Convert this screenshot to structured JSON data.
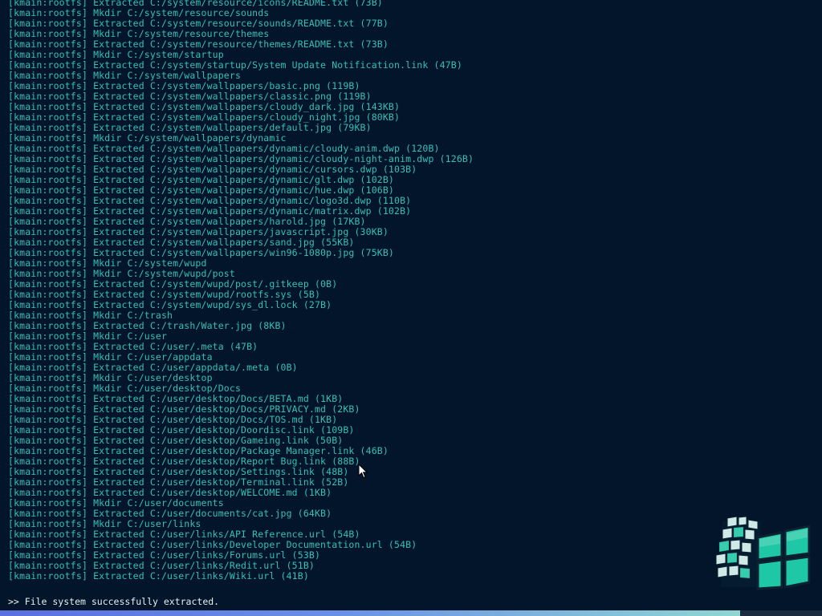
{
  "log": {
    "lines": [
      "[kmain:rootfs] Extracted C:/system/resource/icons/README.txt (73B)",
      "[kmain:rootfs] Mkdir C:/system/resource/sounds",
      "[kmain:rootfs] Extracted C:/system/resource/sounds/README.txt (77B)",
      "[kmain:rootfs] Mkdir C:/system/resource/themes",
      "[kmain:rootfs] Extracted C:/system/resource/themes/README.txt (73B)",
      "[kmain:rootfs] Mkdir C:/system/startup",
      "[kmain:rootfs] Extracted C:/system/startup/System Update Notification.link (47B)",
      "[kmain:rootfs] Mkdir C:/system/wallpapers",
      "[kmain:rootfs] Extracted C:/system/wallpapers/basic.png (119B)",
      "[kmain:rootfs] Extracted C:/system/wallpapers/classic.png (119B)",
      "[kmain:rootfs] Extracted C:/system/wallpapers/cloudy_dark.jpg (143KB)",
      "[kmain:rootfs] Extracted C:/system/wallpapers/cloudy_night.jpg (80KB)",
      "[kmain:rootfs] Extracted C:/system/wallpapers/default.jpg (79KB)",
      "[kmain:rootfs] Mkdir C:/system/wallpapers/dynamic",
      "[kmain:rootfs] Extracted C:/system/wallpapers/dynamic/cloudy-anim.dwp (120B)",
      "[kmain:rootfs] Extracted C:/system/wallpapers/dynamic/cloudy-night-anim.dwp (126B)",
      "[kmain:rootfs] Extracted C:/system/wallpapers/dynamic/cursors.dwp (103B)",
      "[kmain:rootfs] Extracted C:/system/wallpapers/dynamic/glt.dwp (102B)",
      "[kmain:rootfs] Extracted C:/system/wallpapers/dynamic/hue.dwp (106B)",
      "[kmain:rootfs] Extracted C:/system/wallpapers/dynamic/logo3d.dwp (110B)",
      "[kmain:rootfs] Extracted C:/system/wallpapers/dynamic/matrix.dwp (102B)",
      "[kmain:rootfs] Extracted C:/system/wallpapers/harold.jpg (17KB)",
      "[kmain:rootfs] Extracted C:/system/wallpapers/javascript.jpg (30KB)",
      "[kmain:rootfs] Extracted C:/system/wallpapers/sand.jpg (55KB)",
      "[kmain:rootfs] Extracted C:/system/wallpapers/win96-1080p.jpg (75KB)",
      "[kmain:rootfs] Mkdir C:/system/wupd",
      "[kmain:rootfs] Mkdir C:/system/wupd/post",
      "[kmain:rootfs] Extracted C:/system/wupd/post/.gitkeep (0B)",
      "[kmain:rootfs] Extracted C:/system/wupd/rootfs.sys (5B)",
      "[kmain:rootfs] Extracted C:/system/wupd/sys_dl.lock (27B)",
      "[kmain:rootfs] Mkdir C:/trash",
      "[kmain:rootfs] Extracted C:/trash/Water.jpg (8KB)",
      "[kmain:rootfs] Mkdir C:/user",
      "[kmain:rootfs] Extracted C:/user/.meta (47B)",
      "[kmain:rootfs] Mkdir C:/user/appdata",
      "[kmain:rootfs] Extracted C:/user/appdata/.meta (0B)",
      "[kmain:rootfs] Mkdir C:/user/desktop",
      "[kmain:rootfs] Mkdir C:/user/desktop/Docs",
      "[kmain:rootfs] Extracted C:/user/desktop/Docs/BETA.md (1KB)",
      "[kmain:rootfs] Extracted C:/user/desktop/Docs/PRIVACY.md (2KB)",
      "[kmain:rootfs] Extracted C:/user/desktop/Docs/TOS.md (1KB)",
      "[kmain:rootfs] Extracted C:/user/desktop/Doordisc.link (109B)",
      "[kmain:rootfs] Extracted C:/user/desktop/Gameing.link (50B)",
      "[kmain:rootfs] Extracted C:/user/desktop/Package Manager.link (46B)",
      "[kmain:rootfs] Extracted C:/user/desktop/Report Bug.link (88B)",
      "[kmain:rootfs] Extracted C:/user/desktop/Settings.link (48B)",
      "[kmain:rootfs] Extracted C:/user/desktop/Terminal.link (52B)",
      "[kmain:rootfs] Extracted C:/user/desktop/WELCOME.md (1KB)",
      "[kmain:rootfs] Mkdir C:/user/documents",
      "[kmain:rootfs] Extracted C:/user/documents/cat.jpg (64KB)",
      "[kmain:rootfs] Mkdir C:/user/links",
      "[kmain:rootfs] Extracted C:/user/links/API Reference.url (54B)",
      "[kmain:rootfs] Extracted C:/user/links/Developer Documentation.url (54B)",
      "[kmain:rootfs] Extracted C:/user/links/Forums.url (53B)",
      "[kmain:rootfs] Extracted C:/user/links/Redit.url (51B)",
      "[kmain:rootfs] Extracted C:/user/links/Wiki.url (41B)"
    ]
  },
  "status": {
    "message": ">> File system successfully extracted."
  },
  "progress": {
    "fraction": 0.9
  },
  "logo": {
    "icon": "windows96-logo-icon"
  },
  "colors": {
    "background": "#03152a",
    "log_text": "#35c0b8",
    "status_text": "#e6eef2",
    "logo_green": "#1ec7a5",
    "logo_light": "#cfe9e6"
  }
}
